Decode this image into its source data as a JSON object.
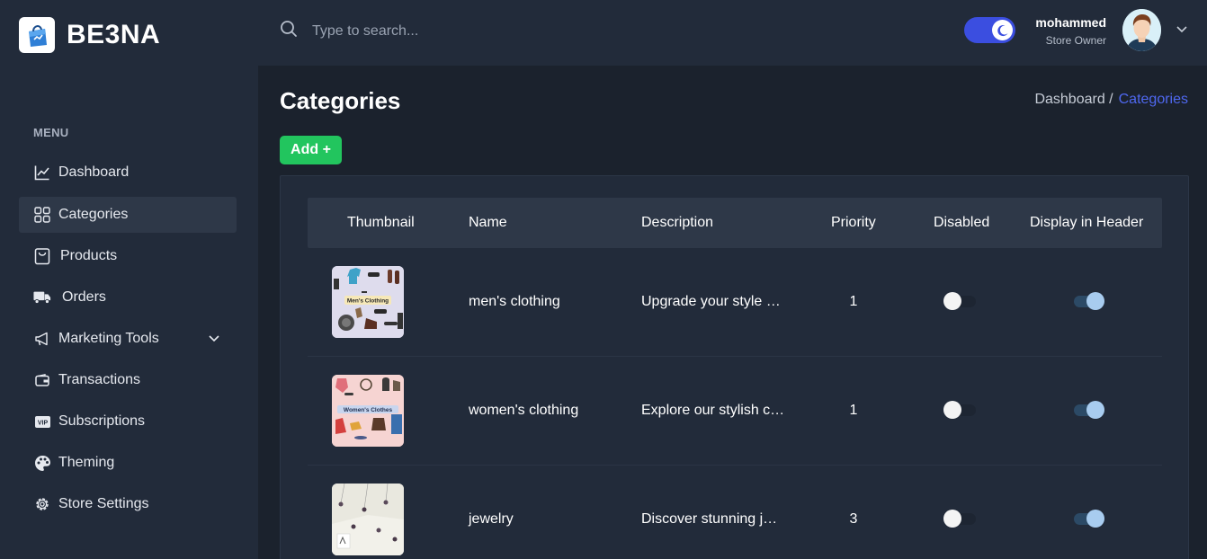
{
  "brand": {
    "name": "BE3NA"
  },
  "search": {
    "placeholder": "Type to search..."
  },
  "user": {
    "name": "mohammed",
    "role": "Store Owner"
  },
  "sidebar": {
    "menu_title": "MENU",
    "items": [
      {
        "label": "Dashboard",
        "icon": "chart-line-icon"
      },
      {
        "label": "Categories",
        "icon": "grid-icon",
        "active": true
      },
      {
        "label": "Products",
        "icon": "shopping-bag-icon"
      },
      {
        "label": "Orders",
        "icon": "truck-icon"
      },
      {
        "label": "Marketing Tools",
        "icon": "megaphone-icon",
        "has_submenu": true
      },
      {
        "label": "Transactions",
        "icon": "wallet-icon"
      },
      {
        "label": "Subscriptions",
        "icon": "vip-icon"
      },
      {
        "label": "Theming",
        "icon": "palette-icon"
      },
      {
        "label": "Store Settings",
        "icon": "gear-icon"
      }
    ]
  },
  "page": {
    "title": "Categories",
    "breadcrumb": {
      "home": "Dashboard /",
      "current": "Categories"
    },
    "add_label": "Add +"
  },
  "table": {
    "columns": [
      "Thumbnail",
      "Name",
      "Description",
      "Priority",
      "Disabled",
      "Display in Header"
    ],
    "rows": [
      {
        "name": "men's clothing",
        "description": "Upgrade your style with our men's clothing collection",
        "priority": "1",
        "disabled": false,
        "display_in_header": true,
        "thumb_label": "Men's Clothing"
      },
      {
        "name": "women's clothing",
        "description": "Explore our stylish collection of women's clothing",
        "priority": "1",
        "disabled": false,
        "display_in_header": true,
        "thumb_label": "Women's Clothes"
      },
      {
        "name": "jewelry",
        "description": "Discover stunning jewelry pieces for every occasion",
        "priority": "3",
        "disabled": false,
        "display_in_header": true,
        "thumb_label": ""
      }
    ]
  },
  "colors": {
    "accent": "#3b4ee0",
    "link": "#4f68f0",
    "add_button": "#22c55e",
    "sidebar_bg": "#222b3a",
    "content_bg": "#1b222d"
  }
}
